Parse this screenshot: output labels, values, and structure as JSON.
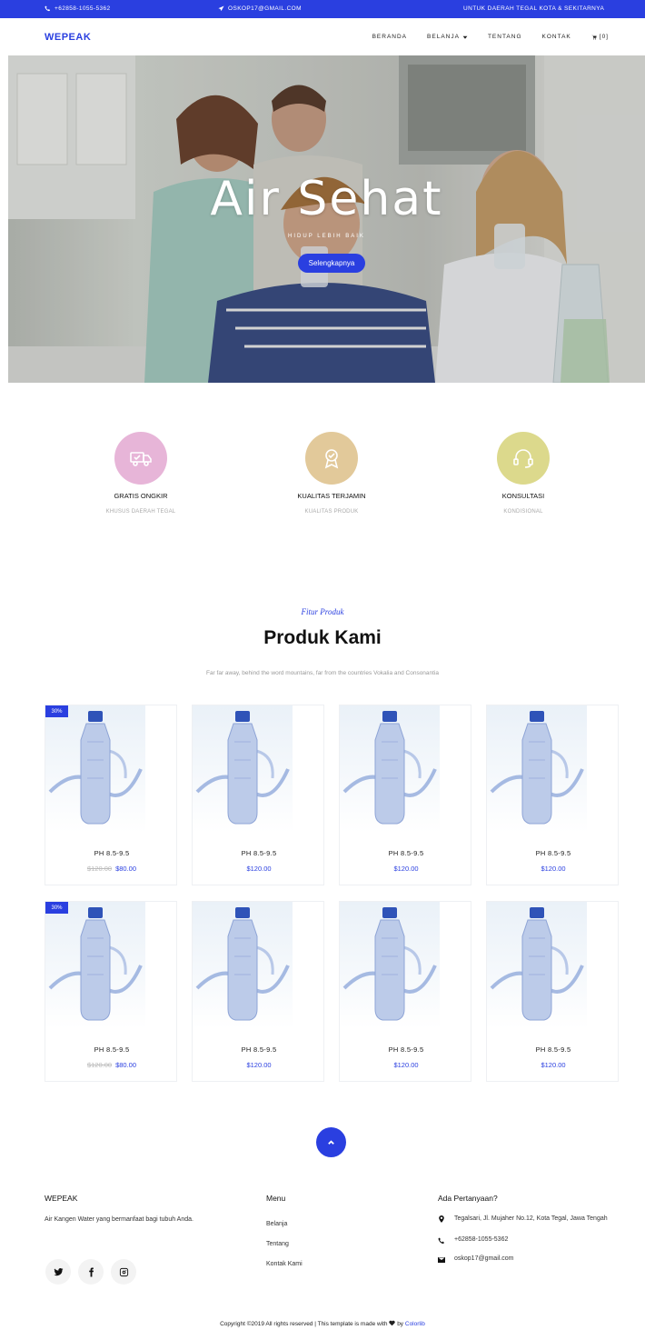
{
  "topbar": {
    "phone": "+62858-1055-5362",
    "email": "OSKOP17@GMAIL.COM",
    "area": "UNTUK DAERAH TEGAL KOTA & SEKITARNYA"
  },
  "nav": {
    "brand": "WEPEAK",
    "items": [
      "BERANDA",
      "BELANJA",
      "TENTANG",
      "KONTAK"
    ],
    "cart": "[0]"
  },
  "hero": {
    "title": "Air Sehat",
    "subtitle": "HIDUP LEBIH BAIK",
    "button": "Selengkapnya"
  },
  "features": [
    {
      "title": "GRATIS ONGKIR",
      "subtitle": "KHUSUS DAERAH TEGAL",
      "color": "#e7b5d8",
      "icon": "delivery-truck-icon"
    },
    {
      "title": "KUALITAS TERJAMIN",
      "subtitle": "KUALITAS PRODUK",
      "color": "#e2c99a",
      "icon": "quality-award-icon"
    },
    {
      "title": "KONSULTASI",
      "subtitle": "KONDISIONAL",
      "color": "#dcd98c",
      "icon": "support-headset-icon"
    }
  ],
  "products_section": {
    "kicker": "Fitur Produk",
    "title": "Produk Kami",
    "description": "Far far away, behind the word mountains, far from the countries Vokalia and Consonantia"
  },
  "products": [
    {
      "name": "PH 8.5-9.5",
      "badge": "30%",
      "old_price": "$120.00",
      "price": "$80.00"
    },
    {
      "name": "PH 8.5-9.5",
      "badge": "",
      "old_price": "",
      "price": "$120.00"
    },
    {
      "name": "PH 8.5-9.5",
      "badge": "",
      "old_price": "",
      "price": "$120.00"
    },
    {
      "name": "PH 8.5-9.5",
      "badge": "",
      "old_price": "",
      "price": "$120.00"
    },
    {
      "name": "PH 8.5-9.5",
      "badge": "30%",
      "old_price": "$120.00",
      "price": "$80.00"
    },
    {
      "name": "PH 8.5-9.5",
      "badge": "",
      "old_price": "",
      "price": "$120.00"
    },
    {
      "name": "PH 8.5-9.5",
      "badge": "",
      "old_price": "",
      "price": "$120.00"
    },
    {
      "name": "PH 8.5-9.5",
      "badge": "",
      "old_price": "",
      "price": "$120.00"
    }
  ],
  "footer": {
    "brand_heading": "WEPEAK",
    "brand_text": "Air Kangen Water yang bermanfaat bagi tubuh Anda.",
    "menu_heading": "Menu",
    "menu_items": [
      "Belanja",
      "Tentang",
      "Kontak Kami"
    ],
    "contact_heading": "Ada Pertanyaan?",
    "address": "Tegalsari, Jl. Mujaher No.12, Kota Tegal, Jawa Tengah",
    "phone": "+62858-1055-5362",
    "email": "oskop17@gmail.com",
    "copyright_before": "Copyright ©2019 All rights reserved | This template is made with",
    "copyright_by": "by",
    "copyright_link": "Colorlib"
  },
  "colors": {
    "accent": "#2a3fe0"
  }
}
